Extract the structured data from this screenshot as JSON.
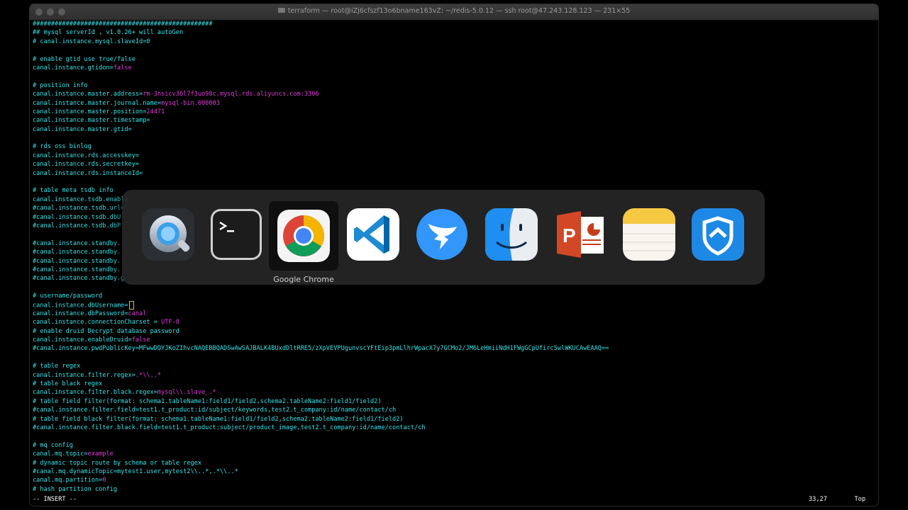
{
  "window": {
    "title": "terraform — root@iZj6cfszf13o6bname163vZ: ~/redis-5.0.12 — ssh root@47.243.128.123 — 231×55"
  },
  "terminal": {
    "lines": [
      {
        "k": "#################################################",
        "v": ""
      },
      {
        "k": "## mysql serverId , v1.0.26+ will autoGen",
        "v": ""
      },
      {
        "k": "# canal.instance.mysql.slaveId=0",
        "v": ""
      },
      {
        "k": "",
        "v": ""
      },
      {
        "k": "# enable gtid use true/false",
        "v": ""
      },
      {
        "k": "canal.instance.gtidon=",
        "v": "false"
      },
      {
        "k": "",
        "v": ""
      },
      {
        "k": "# position info",
        "v": ""
      },
      {
        "k": "canal.instance.master.address=",
        "v": "rm-3nsicv36l7f3uo98c.mysql.rds.aliyuncs.com:3306"
      },
      {
        "k": "canal.instance.master.journal.name=",
        "v": "mysql-bin.000003"
      },
      {
        "k": "canal.instance.master.position=",
        "v": "24471"
      },
      {
        "k": "canal.instance.master.timestamp=",
        "v": ""
      },
      {
        "k": "canal.instance.master.gtid=",
        "v": ""
      },
      {
        "k": "",
        "v": ""
      },
      {
        "k": "# rds oss binlog",
        "v": ""
      },
      {
        "k": "canal.instance.rds.accesskey=",
        "v": ""
      },
      {
        "k": "canal.instance.rds.secretkey=",
        "v": ""
      },
      {
        "k": "canal.instance.rds.instanceId=",
        "v": ""
      },
      {
        "k": "",
        "v": ""
      },
      {
        "k": "# table meta tsdb info",
        "v": ""
      },
      {
        "k": "canal.instance.tsdb.enable",
        "v": ""
      },
      {
        "k": "#canal.instance.tsdb.url=",
        "v": ""
      },
      {
        "k": "#canal.instance.tsdb.dbU",
        "v": ""
      },
      {
        "k": "#canal.instance.tsdb.dbP",
        "v": ""
      },
      {
        "k": "",
        "v": ""
      },
      {
        "k": "#canal.instance.standby.",
        "v": ""
      },
      {
        "k": "#canal.instance.standby.",
        "v": ""
      },
      {
        "k": "#canal.instance.standby.",
        "v": ""
      },
      {
        "k": "#canal.instance.standby.",
        "v": ""
      },
      {
        "k": "#canal.instance.standby.g",
        "v": ""
      },
      {
        "k": "",
        "v": ""
      },
      {
        "k": "# username/password",
        "v": ""
      },
      {
        "k": "canal.instance.dbUsername=",
        "v": "",
        "cursor": true
      },
      {
        "k": "canal.instance.dbPassword=",
        "v": "canal"
      },
      {
        "k": "canal.instance.connectionCharset = ",
        "v": "UTF-8"
      },
      {
        "k": "# enable druid Decrypt database password",
        "v": ""
      },
      {
        "k": "canal.instance.enableDruid=",
        "v": "false"
      },
      {
        "k": "#canal.instance.pwdPublicKey=MFwwDQYJKoZIhvcNAQEBBQADSwAwSAJBALK4BUxdDltRRE5/zXpVEVPUgunvscYFtEip3pmLlhrWpacX7y7GCMo2/JM6LeHmiiNdH1FWgGCpUfircSwlWKUCAwEAAQ==",
        "v": ""
      },
      {
        "k": "",
        "v": ""
      },
      {
        "k": "# table regex",
        "v": ""
      },
      {
        "k": "canal.instance.filter.regex=",
        "v": ".*\\\\..*"
      },
      {
        "k": "# table black regex",
        "v": ""
      },
      {
        "k": "canal.instance.filter.black.regex=",
        "v": "mysql\\\\.slave_.*"
      },
      {
        "k": "# table field filter(format: schema1.tableName1:field1/field2,schema2.tableName2:field1/field2)",
        "v": ""
      },
      {
        "k": "#canal.instance.filter.field=test1.t_product:id/subject/keywords,test2.t_company:id/name/contact/ch",
        "v": ""
      },
      {
        "k": "# table field black filter(format: schema1.tableName1:field1/field2,schema2.tableName2:field1/field2)",
        "v": ""
      },
      {
        "k": "#canal.instance.filter.black.field=test1.t_product:subject/product_image,test2.t_company:id/name/contact/ch",
        "v": ""
      },
      {
        "k": "",
        "v": ""
      },
      {
        "k": "# mq config",
        "v": ""
      },
      {
        "k": "canal.mq.topic=",
        "v": "example"
      },
      {
        "k": "# dynamic topic route by schema or table regex",
        "v": ""
      },
      {
        "k": "#canal.mq.dynamicTopic=mytest1.user,mytest2\\\\..*,.*\\\\..*",
        "v": ""
      },
      {
        "k": "canal.mq.partition=",
        "v": "0"
      },
      {
        "k": "# hash partition config",
        "v": ""
      }
    ]
  },
  "status": {
    "mode": "-- INSERT --",
    "position": "33,27",
    "scroll": "Top"
  },
  "switcher": {
    "selected_label": "Google Chrome",
    "apps": [
      {
        "name": "QuickTime Player",
        "icon": "quicktime-icon"
      },
      {
        "name": "Terminal",
        "icon": "terminal-icon"
      },
      {
        "name": "Google Chrome",
        "icon": "chrome-icon"
      },
      {
        "name": "Visual Studio Code",
        "icon": "vscode-icon"
      },
      {
        "name": "DingTalk",
        "icon": "dingtalk-icon"
      },
      {
        "name": "Finder",
        "icon": "finder-icon"
      },
      {
        "name": "Microsoft PowerPoint",
        "icon": "powerpoint-icon"
      },
      {
        "name": "Notes",
        "icon": "notes-icon"
      },
      {
        "name": "Shield App",
        "icon": "shield-icon"
      }
    ]
  },
  "colors": {
    "key": "#37e3e8",
    "value": "#e13bd7",
    "cursor": "#e6b94a"
  }
}
